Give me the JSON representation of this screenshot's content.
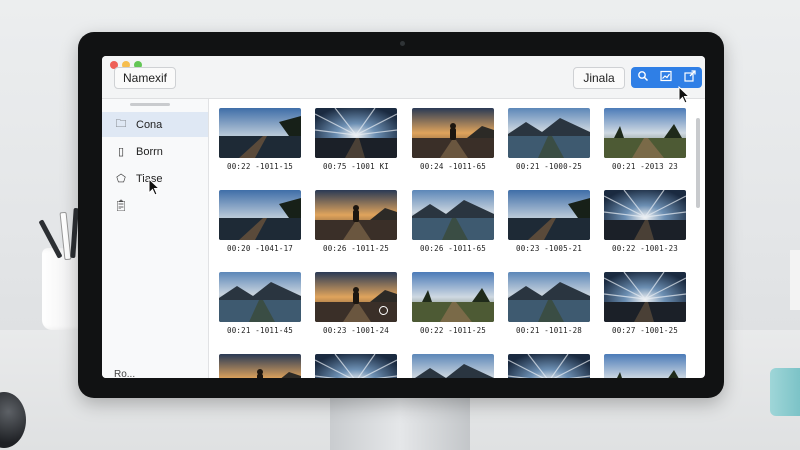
{
  "window": {
    "app_name": "Namexif",
    "search_label": "Jinala",
    "toolbar_icons": [
      "search-icon",
      "chart-icon",
      "share-icon"
    ],
    "accent_color": "#2f7fe6"
  },
  "sidebar": {
    "items": [
      {
        "label": "Cona",
        "icon": "folder-icon",
        "active": true
      },
      {
        "label": "Borrn",
        "icon": "document-icon",
        "active": false
      },
      {
        "label": "Tiase",
        "icon": "tag-icon",
        "active": false
      },
      {
        "label": "",
        "icon": "clipboard-icon",
        "active": false
      }
    ],
    "bottom_label": "Ro..."
  },
  "photos": [
    {
      "caption": "00:22 -1011-15",
      "scene": "pier"
    },
    {
      "caption": "00:75 -1001 KI",
      "scene": "sunburst"
    },
    {
      "caption": "00:24 -1011-65",
      "scene": "sunset-person"
    },
    {
      "caption": "00:21 -1000-25",
      "scene": "lake-mountain"
    },
    {
      "caption": "00:21 -2013 23",
      "scene": "field"
    },
    {
      "caption": "00:20 -1041-17",
      "scene": "pier"
    },
    {
      "caption": "00:26 -1011-25",
      "scene": "sunset-person"
    },
    {
      "caption": "00:26 -1011-65",
      "scene": "lake-mountain"
    },
    {
      "caption": "00:23 -1005-21",
      "scene": "pier"
    },
    {
      "caption": "00:22 -1001-23",
      "scene": "sunburst"
    },
    {
      "caption": "00:21 -1011-45",
      "scene": "lake-mountain"
    },
    {
      "caption": "00:23 -1001-24",
      "scene": "sunset-person"
    },
    {
      "caption": "00:22 -1011-25",
      "scene": "field"
    },
    {
      "caption": "00:21 -1011-28",
      "scene": "lake-mountain"
    },
    {
      "caption": "00:27 -1001-25",
      "scene": "sunburst"
    },
    {
      "caption": "",
      "scene": "sunset-person"
    },
    {
      "caption": "",
      "scene": "sunburst"
    },
    {
      "caption": "",
      "scene": "lake-mountain"
    },
    {
      "caption": "",
      "scene": "sunburst"
    },
    {
      "caption": "",
      "scene": "field"
    }
  ]
}
